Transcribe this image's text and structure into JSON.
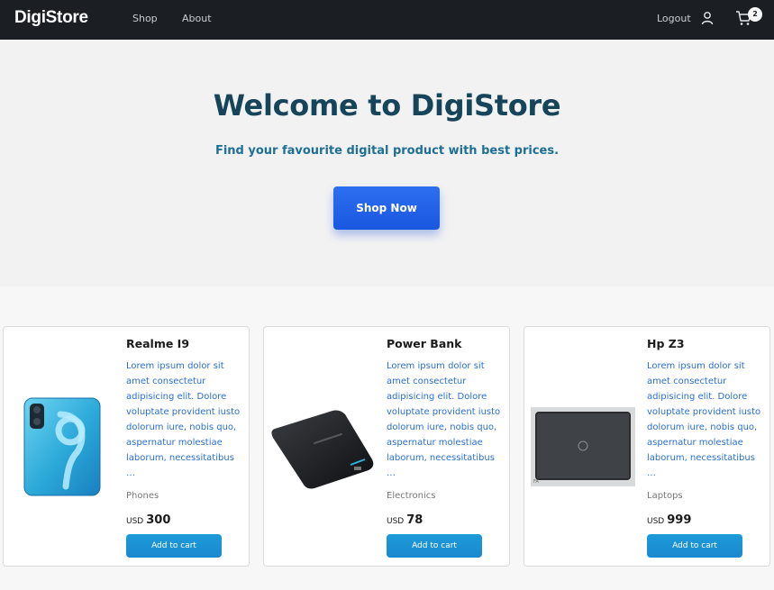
{
  "navbar": {
    "logo": "DigiStore",
    "links": [
      "Shop",
      "About"
    ],
    "logout": "Logout",
    "cart_count": "2"
  },
  "hero": {
    "title": "Welcome to DigiStore",
    "subtitle": "Find your favourite digital product with best prices.",
    "cta": "Shop Now"
  },
  "products": [
    {
      "name": "Realme I9",
      "description": "Lorem ipsum dolor sit amet consectetur adipisicing elit. Dolore voluptate provident iusto dolorum iure, nobis quo, aspernatur molestiae laborum, necessitatibus …",
      "category": "Phones",
      "currency": "USD",
      "price": "300",
      "button": "Add to cart"
    },
    {
      "name": "Power Bank",
      "description": "Lorem ipsum dolor sit amet consectetur adipisicing elit. Dolore voluptate provident iusto dolorum iure, nobis quo, aspernatur molestiae laborum, necessitatibus …",
      "category": "Electronics",
      "currency": "USD",
      "price": "78",
      "button": "Add to cart"
    },
    {
      "name": "Hp Z3",
      "description": "Lorem ipsum dolor sit amet consectetur adipisicing elit. Dolore voluptate provident iusto dolorum iure, nobis quo, aspernatur molestiae laborum, necessitatibus …",
      "category": "Laptops",
      "currency": "USD",
      "price": "999",
      "button": "Add to cart"
    }
  ],
  "colors": {
    "navbar_bg": "#1b1f24",
    "hero_title": "#16455a",
    "hero_subtitle": "#1e6f95",
    "cta": "#2e6ff0",
    "description": "#2a6fd0",
    "add_to_cart": "#1d9bd8"
  },
  "icons": [
    "user-icon",
    "cart-icon"
  ]
}
